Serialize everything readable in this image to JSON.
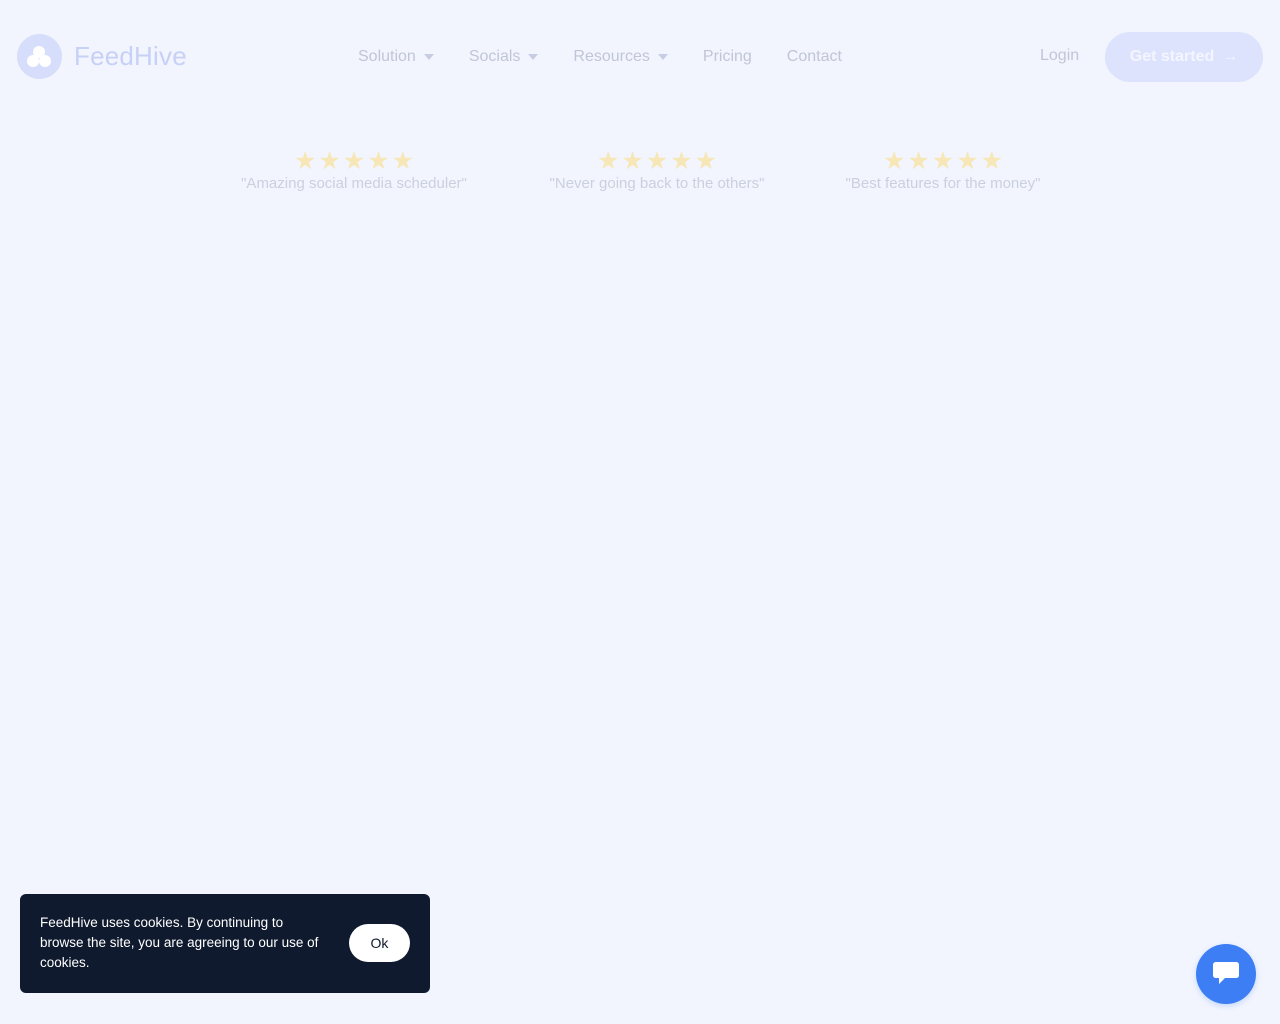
{
  "brand": {
    "name": "FeedHive",
    "logo_icon": "feedhive-logo-icon"
  },
  "nav": {
    "items": [
      {
        "label": "Solution",
        "has_dropdown": true
      },
      {
        "label": "Socials",
        "has_dropdown": true
      },
      {
        "label": "Resources",
        "has_dropdown": true
      },
      {
        "label": "Pricing",
        "has_dropdown": false
      },
      {
        "label": "Contact",
        "has_dropdown": false
      }
    ],
    "caret_icon": "caret-down-icon"
  },
  "header_actions": {
    "login_label": "Login",
    "cta_label": "Get started",
    "cta_icon": "arrow-right-icon"
  },
  "ratings": [
    {
      "stars": 5,
      "quote": "\"Amazing social media scheduler\""
    },
    {
      "stars": 5,
      "quote": "\"Never going back to the others\""
    },
    {
      "stars": 5,
      "quote": "\"Best features for the money\""
    }
  ],
  "cookie_banner": {
    "text": "FeedHive uses cookies. By continuing to browse the site, you are agreeing to our use of cookies.",
    "ok_label": "Ok"
  },
  "chat": {
    "icon": "chat-bubble-icon"
  },
  "colors": {
    "background": "#f2f5fe",
    "star": "#f7e6b6",
    "cookie_bg": "#101a2e",
    "chat_button": "#3d7ef5",
    "cta_bg": "#dde2fd"
  }
}
